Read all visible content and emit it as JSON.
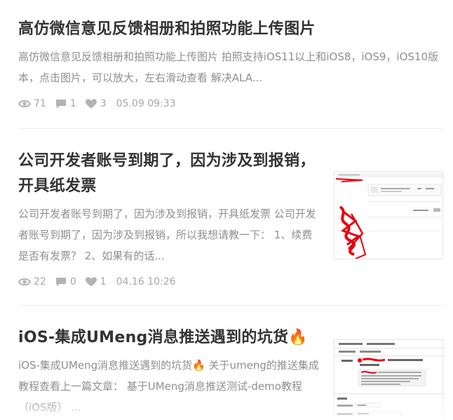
{
  "articles": [
    {
      "title": "高仿微信意见反馈相册和拍照功能上传图片",
      "abstract": "高仿微信意见反馈相册和拍照功能上传图片 拍照支持iOS11以上和iOS8，iOS9，iOS10版本，点击图片，可以放大，左右滑动查看 解决ALA...",
      "views": "71",
      "comments": "1",
      "likes": "3",
      "time": "05.09 09:33"
    },
    {
      "title": "公司开发者账号到期了，因为涉及到报销，开具纸发票",
      "abstract": "公司开发者账号到期了，因为涉及到报销，开具纸发票 公司开发者账号到期了，因为涉及到报销，所以我想请教一下： 1、续费是否有发票？ 2、如果有的话...",
      "views": "22",
      "comments": "0",
      "likes": "1",
      "time": "04.16 10:26",
      "thumbnail": "screenshot-with-red-scribbles"
    },
    {
      "title": "iOS-集成UMeng消息推送遇到的坑货🔥",
      "abstract": "iOS-集成UMeng消息推送遇到的坑货🔥 关于umeng的推送集成教程查看上一篇文章： 基于UMeng消息推送测试-demo教程（iOS版） ...",
      "thumbnail": "xcode-signing-screenshot"
    }
  ],
  "icons": {
    "views": "eye-icon",
    "comments": "comment-icon",
    "likes": "heart-icon"
  },
  "colors": {
    "title": "#333333",
    "abstract": "#8f8f8f",
    "meta": "#a7a7a7",
    "annotation_red": "#e8000b"
  }
}
